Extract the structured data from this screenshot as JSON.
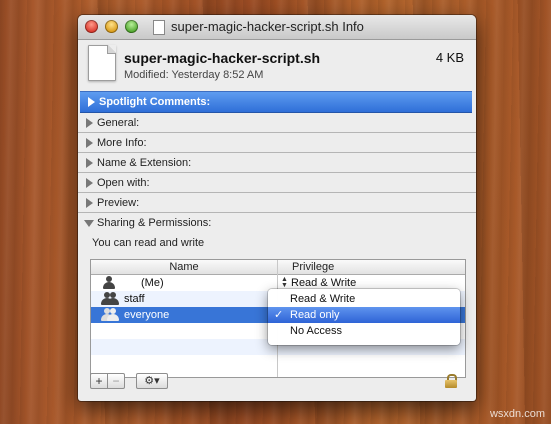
{
  "window": {
    "title": "super-magic-hacker-script.sh Info"
  },
  "file": {
    "name": "super-magic-hacker-script.sh",
    "size": "4 KB",
    "modified": "Modified: Yesterday 8:52 AM"
  },
  "sections": [
    {
      "label": "Spotlight Comments:",
      "state": "selected"
    },
    {
      "label": "General:"
    },
    {
      "label": "More Info:"
    },
    {
      "label": "Name & Extension:"
    },
    {
      "label": "Open with:"
    },
    {
      "label": "Preview:"
    },
    {
      "label": "Sharing & Permissions:",
      "expanded": true
    }
  ],
  "permissions": {
    "summary": "You can read and write",
    "columns": {
      "name": "Name",
      "privilege": "Privilege"
    },
    "rows": [
      {
        "name": "(Me)",
        "privilege": "Read & Write",
        "icon": "user-icon"
      },
      {
        "name": "staff",
        "privilege": "",
        "icon": "group-icon"
      },
      {
        "name": "everyone",
        "privilege": "",
        "icon": "everyone-icon"
      }
    ]
  },
  "privilege_menu": {
    "options": [
      "Read & Write",
      "Read only",
      "No Access"
    ],
    "selected": "Read only",
    "check": "✓"
  },
  "toolbar": {
    "add": "+",
    "remove": "−",
    "action": "⚙▾"
  },
  "watermark": "wsxdn.com",
  "colors": {
    "selection": "#3875d7",
    "background": "#a55628"
  }
}
